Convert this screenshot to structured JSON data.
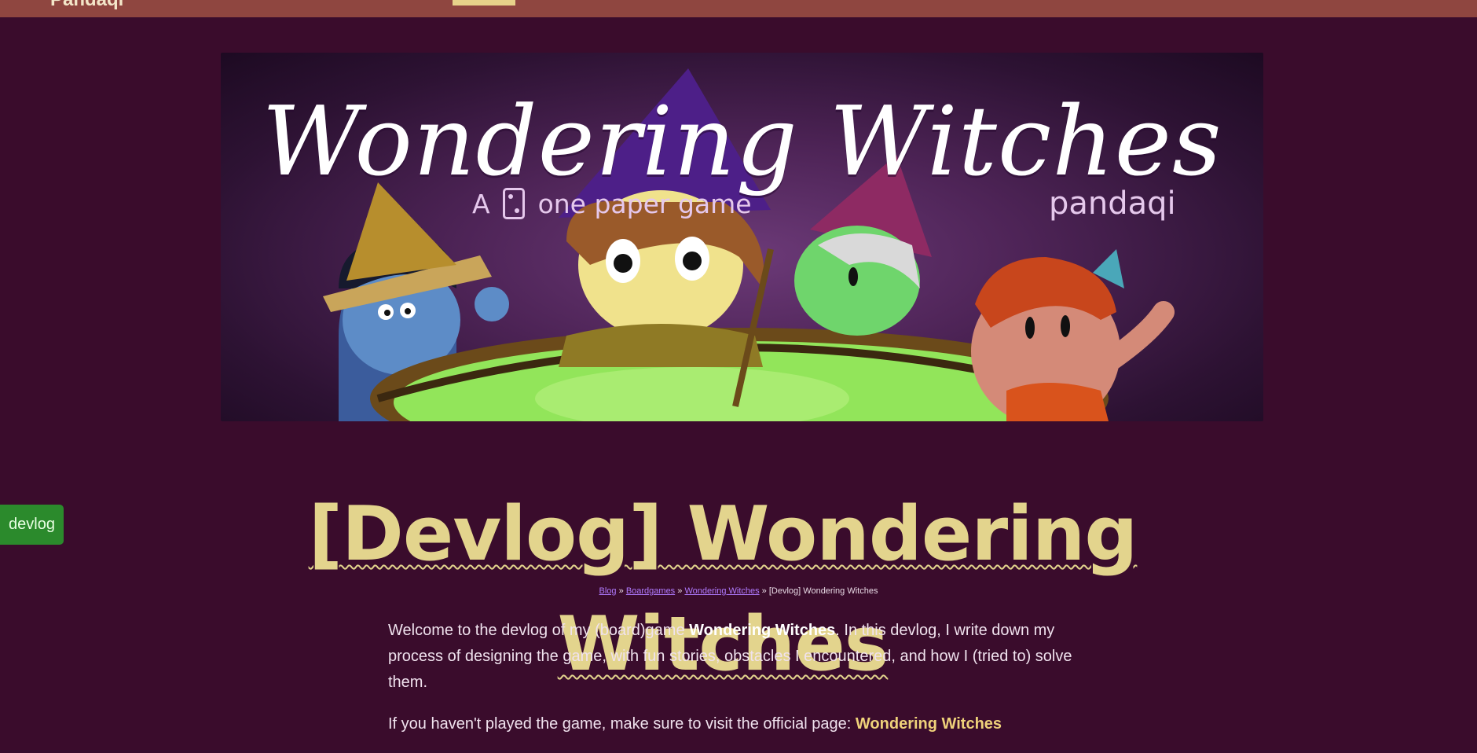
{
  "topbar": {
    "logo": "Pandaqi",
    "button_label": ""
  },
  "hero": {
    "title": "Wondering Witches",
    "tagline_before": "A",
    "tagline_after": "one paper game",
    "brand": "pandaqi"
  },
  "tag": {
    "label": "devlog"
  },
  "page": {
    "title": "[Devlog] Wondering Witches"
  },
  "breadcrumb": {
    "items": [
      "Blog",
      "Boardgames",
      "Wondering Witches"
    ],
    "separator": "»",
    "current": "[Devlog] Wondering Witches"
  },
  "content": {
    "intro_before": "Welcome to the devlog of my (board)game ",
    "intro_game": "Wondering Witches",
    "intro_after": ". In this devlog, I write down my process of designing the game, with fun stories, obstacles I encountered, and how I (tried to) solve them.",
    "visit_before": "If you haven't played the game, make sure to visit the official page: ",
    "visit_link": "Wondering Witches"
  },
  "colors": {
    "background": "#3a0c2c",
    "topbar": "#8f4640",
    "title": "#e3d48d",
    "link": "#b07bff",
    "tag": "#2b8a2c"
  }
}
